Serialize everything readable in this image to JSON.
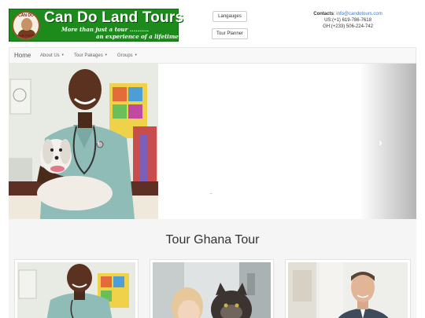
{
  "logo": {
    "title": "Can Do Land Tours",
    "tagline_1": "More than just a tour ..........",
    "tagline_2": "an experience of a lifetime",
    "badge_top": "CAN DO",
    "badge_bottom": "LAND TOURS"
  },
  "header": {
    "languages_label": "Langauges",
    "tour_planner_label": "Tour Planner"
  },
  "contacts": {
    "label": "Contacts",
    "email": "info@candotours.com",
    "us_phone": "US:(+1) 619-786-7618",
    "gh_phone": "GH:(+233) 506-224-742"
  },
  "navbar": {
    "brand": "Home",
    "items": [
      {
        "label": "About Us"
      },
      {
        "label": "Tour Pakages"
      },
      {
        "label": "Groups"
      }
    ]
  },
  "carousel": {
    "slides": 3,
    "active_index": 2
  },
  "section": {
    "title": "Tour Ghana Tour"
  },
  "colors": {
    "logo_green": "#1c8b1c",
    "link_blue": "#3b76c4",
    "scrub_teal": "#8fbcb6"
  },
  "icons": {
    "next": "chevron-right-icon",
    "prev": "chevron-left-icon"
  }
}
